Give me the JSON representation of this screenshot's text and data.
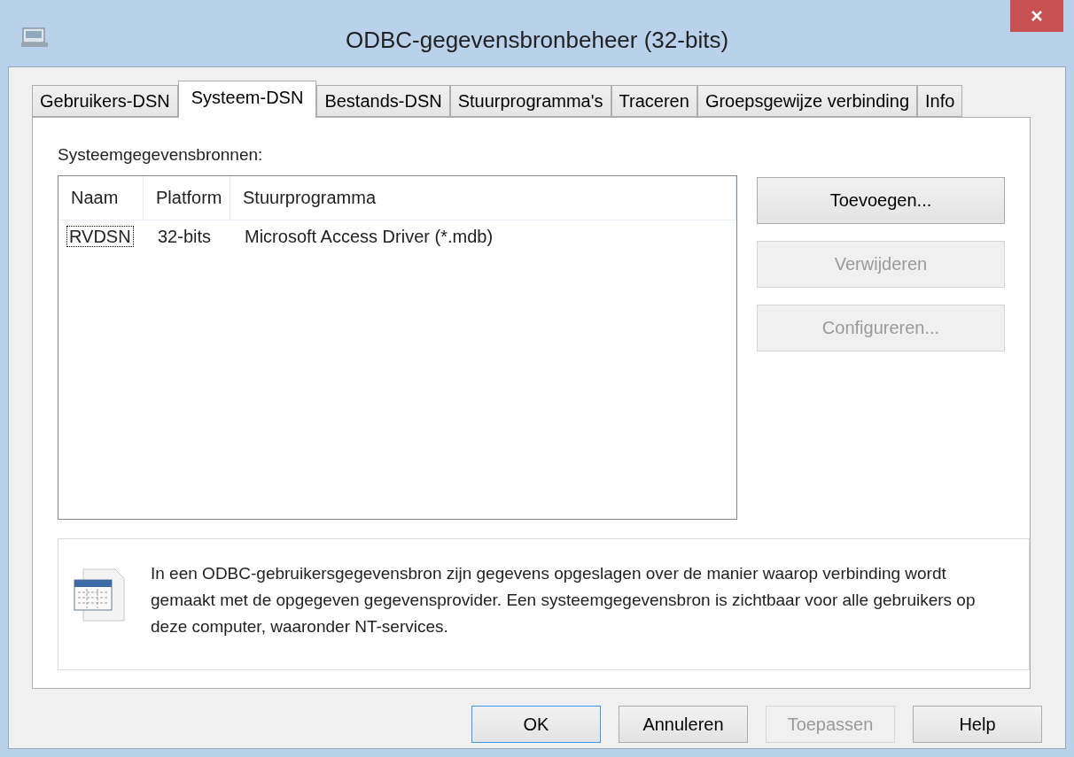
{
  "window": {
    "title": "ODBC-gegevensbronbeheer (32-bits)"
  },
  "tabs": [
    {
      "label": "Gebruikers-DSN",
      "selected": false
    },
    {
      "label": "Systeem-DSN",
      "selected": true
    },
    {
      "label": "Bestands-DSN",
      "selected": false
    },
    {
      "label": "Stuurprogramma's",
      "selected": false
    },
    {
      "label": "Traceren",
      "selected": false
    },
    {
      "label": "Groepsgewijze verbinding",
      "selected": false
    },
    {
      "label": "Info",
      "selected": false
    }
  ],
  "list_label": "Systeemgegevensbronnen:",
  "table": {
    "columns": [
      "Naam",
      "Platform",
      "Stuurprogramma"
    ],
    "rows": [
      {
        "cells": [
          "RVDSN",
          "32-bits",
          "Microsoft Access Driver (*.mdb)"
        ],
        "focused": true
      }
    ]
  },
  "side_buttons": [
    {
      "label": "Toevoegen...",
      "disabled": false
    },
    {
      "label": "Verwijderen",
      "disabled": true
    },
    {
      "label": "Configureren...",
      "disabled": true
    }
  ],
  "info_text": "In een ODBC-gebruikersgegevensbron zijn gegevens opgeslagen over de manier waarop verbinding wordt gemaakt met de opgegeven gegevensprovider. Een systeemgegevensbron is zichtbaar voor alle gebruikers op deze computer, waaronder NT-services.",
  "footer_buttons": [
    {
      "label": "OK",
      "disabled": false,
      "default": true
    },
    {
      "label": "Annuleren",
      "disabled": false,
      "default": false
    },
    {
      "label": "Toepassen",
      "disabled": true,
      "default": false
    },
    {
      "label": "Help",
      "disabled": false,
      "default": false
    }
  ]
}
